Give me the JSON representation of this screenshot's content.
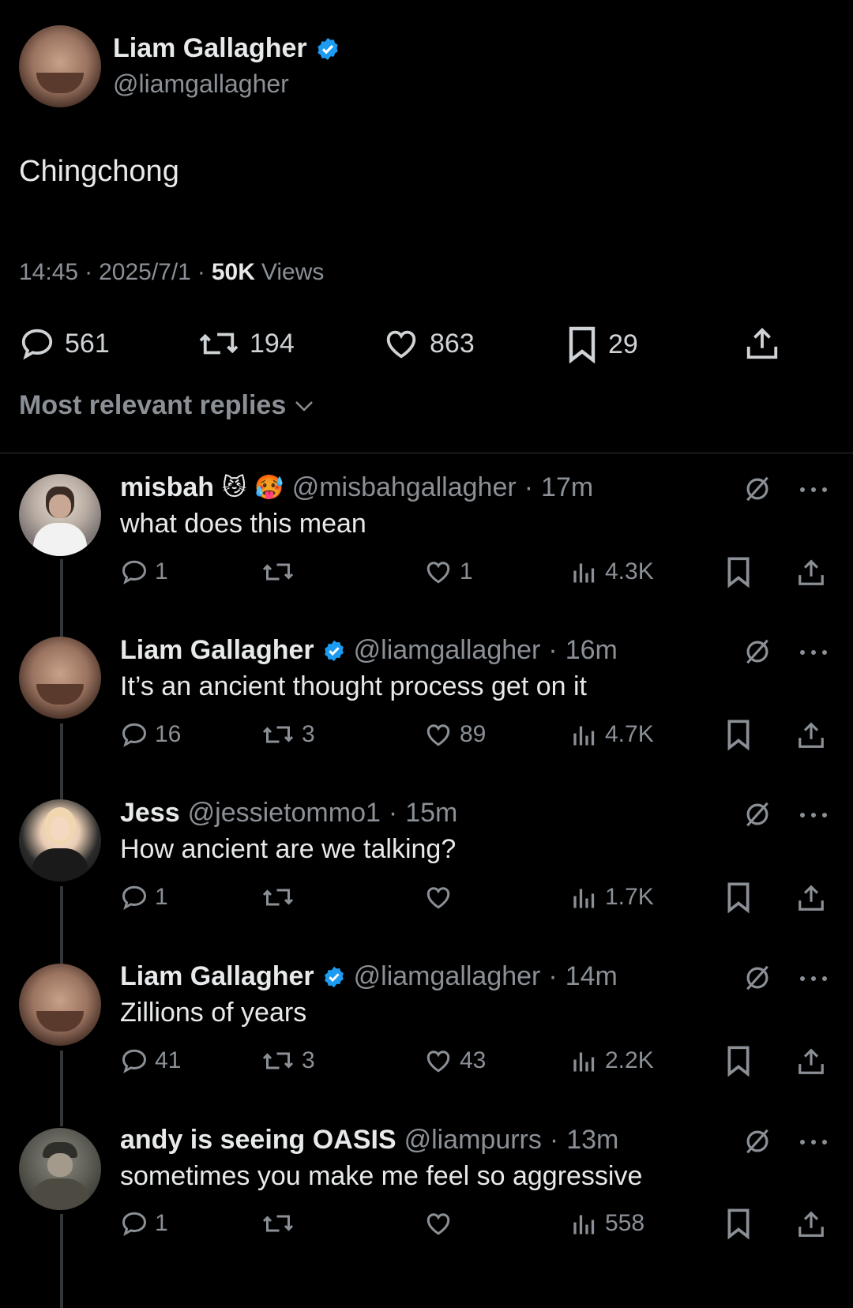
{
  "main_tweet": {
    "author_name": "Liam Gallagher",
    "handle": "@liamgallagher",
    "text": "Chingchong",
    "time": "14:45",
    "date": "2025/7/1",
    "views_count": "50K",
    "views_label": "Views",
    "replies": "561",
    "retweets": "194",
    "likes": "863",
    "bookmarks": "29"
  },
  "sort_label": "Most relevant replies",
  "replies": [
    {
      "name": "misbah",
      "handle": "@misbahgallagher",
      "time": "17m",
      "text": "what does this mean",
      "replies": "1",
      "retweets": "",
      "likes": "1",
      "views": "4.3K",
      "verified": false
    },
    {
      "name": "Liam Gallagher",
      "handle": "@liamgallagher",
      "time": "16m",
      "text": "It’s an ancient thought process get on it",
      "replies": "16",
      "retweets": "3",
      "likes": "89",
      "views": "4.7K",
      "verified": true
    },
    {
      "name": "Jess",
      "handle": "@jessietommo1",
      "time": "15m",
      "text": "How ancient are we talking?",
      "replies": "1",
      "retweets": "",
      "likes": "",
      "views": "1.7K",
      "verified": false
    },
    {
      "name": "Liam Gallagher",
      "handle": "@liamgallagher",
      "time": "14m",
      "text": "Zillions of years",
      "replies": "41",
      "retweets": "3",
      "likes": "43",
      "views": "2.2K",
      "verified": true
    },
    {
      "name": "andy is seeing OASIS",
      "handle": "@liampurrs",
      "time": "13m",
      "text": "sometimes you make me feel so aggressive",
      "replies": "1",
      "retweets": "",
      "likes": "",
      "views": "558",
      "verified": false
    }
  ],
  "colors": {
    "accent": "#1d9bf0",
    "muted": "#8b9096",
    "background": "#000000",
    "text": "#e7e9ea"
  }
}
